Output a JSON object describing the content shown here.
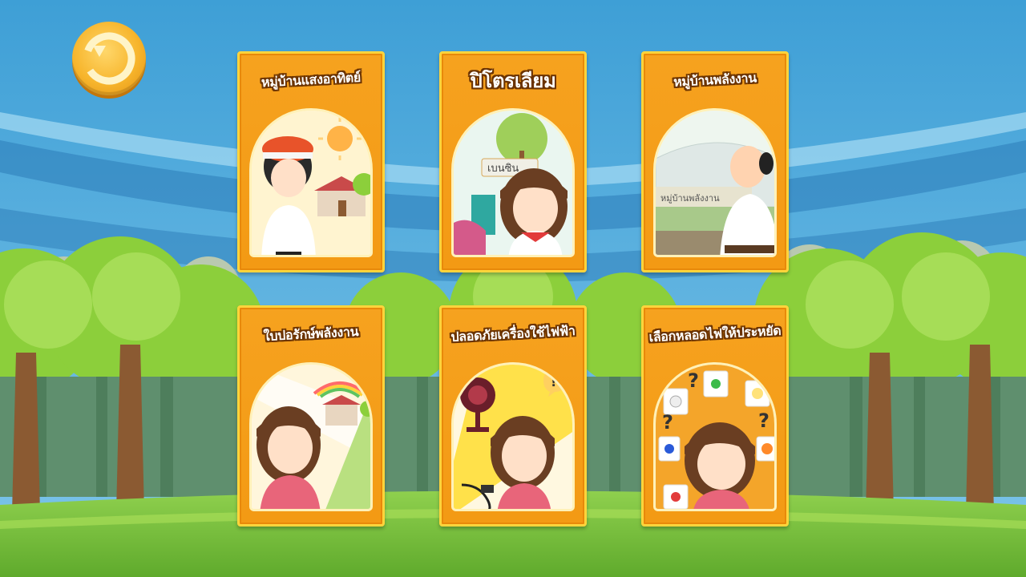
{
  "back_button": {
    "icon": "back-icon"
  },
  "cards": [
    {
      "title": "หมู่บ้านแสงอาทิตย์",
      "art": "solar-village-illustration"
    },
    {
      "title": "ปิโตรเลียม",
      "art": "petroleum-illustration",
      "sign_text": "เบนซิน"
    },
    {
      "title": "หมู่บ้านพลังงาน",
      "art": "energy-village-illustration",
      "sign_text": "หมู่บ้านพลังงาน"
    },
    {
      "title": "ใบปอรักษ์พลังงาน",
      "art": "energy-conservation-illustration"
    },
    {
      "title": "ปลอดภัยเครื่องใช้ไฟฟ้า",
      "art": "electrical-safety-illustration"
    },
    {
      "title": "เลือกหลอดไฟให้ประหยัด",
      "art": "choose-lightbulb-illustration"
    }
  ],
  "colors": {
    "sky": "#4aa7d8",
    "card_orange": "#f39a14",
    "card_border": "#ffd43b",
    "grass": "#7cc443",
    "title_outline": "#6b3300"
  }
}
